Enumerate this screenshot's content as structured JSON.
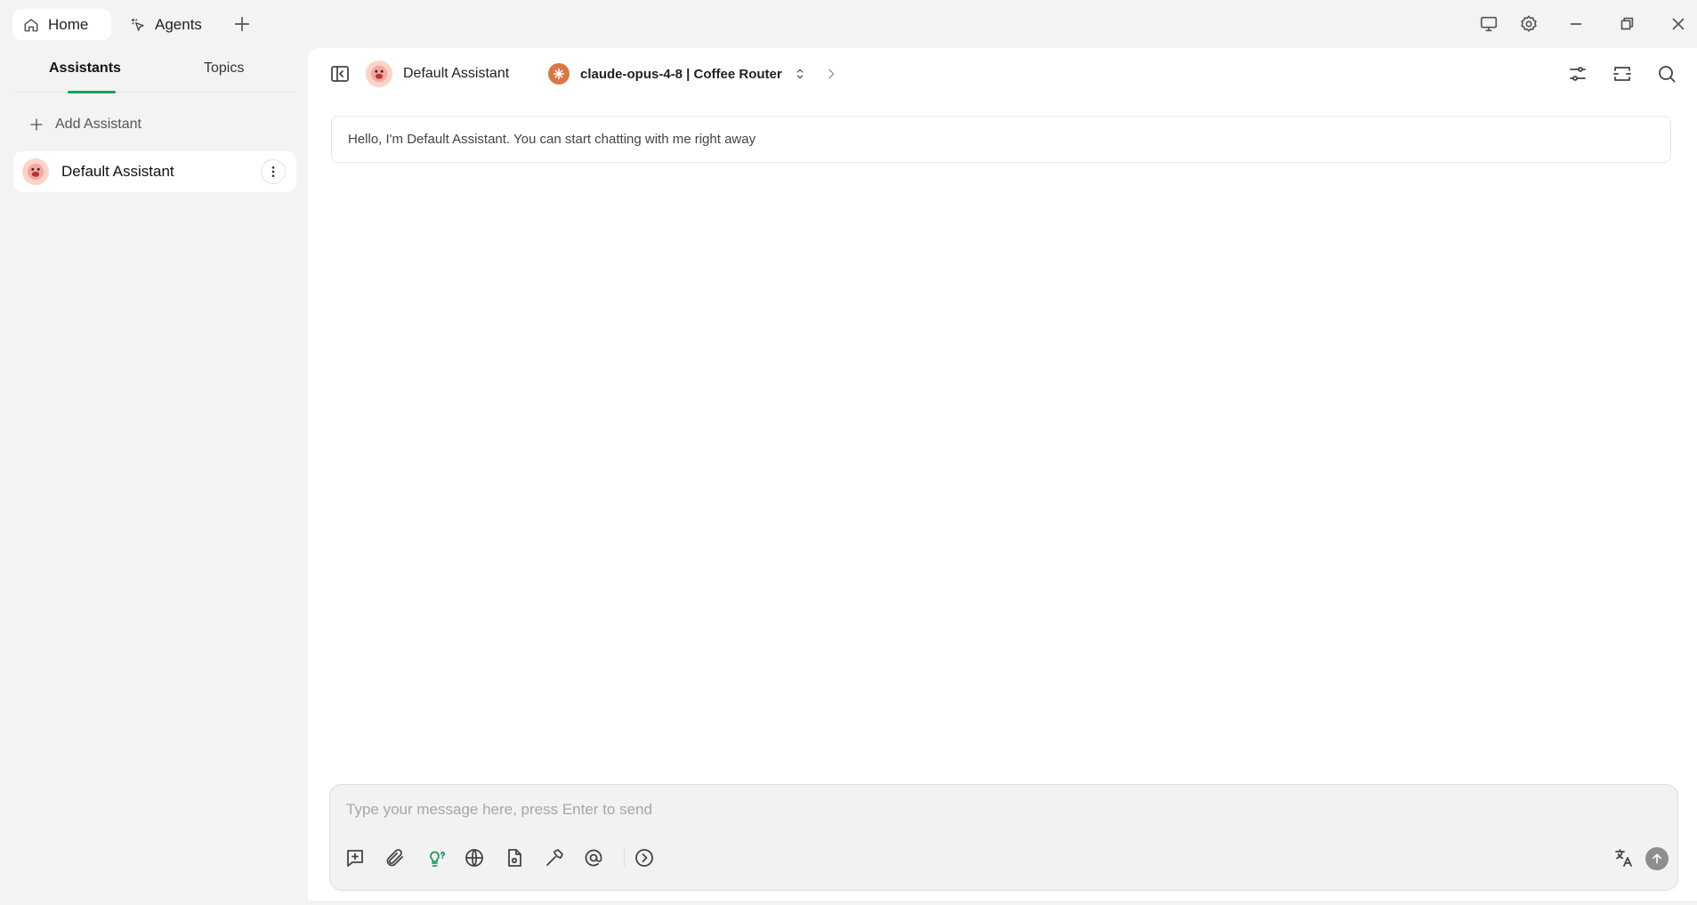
{
  "tabs": [
    {
      "label": "Home",
      "icon": "home-icon",
      "active": true
    },
    {
      "label": "Agents",
      "icon": "sparkle-pointer-icon",
      "active": false
    }
  ],
  "window_controls": [
    "monitor-icon",
    "gear-icon",
    "minimize-icon",
    "restore-icon",
    "close-icon"
  ],
  "sidebar": {
    "tabs": [
      {
        "label": "Assistants",
        "active": true
      },
      {
        "label": "Topics",
        "active": false
      }
    ],
    "add_assistant_label": "Add Assistant",
    "assistants": [
      {
        "name": "Default Assistant",
        "avatar": "emoji-face-avatar"
      }
    ]
  },
  "header": {
    "assistant_name": "Default Assistant",
    "model_label": "claude-opus-4-8 | Coffee Router",
    "right_icons": [
      "settings-sliders-icon",
      "expand-icon",
      "search-icon"
    ]
  },
  "chat": {
    "welcome_message": "Hello, I'm Default Assistant. You can start chatting with me right away"
  },
  "composer": {
    "placeholder": "Type your message here, press Enter to send",
    "value": "",
    "tools": [
      "new-topic-icon",
      "attachment-icon",
      "thinking-bulb-icon",
      "web-search-icon",
      "knowledge-file-icon",
      "mcp-hammer-icon",
      "mention-icon",
      "more-arrow-icon"
    ],
    "right_tools": [
      "translate-icon",
      "send-icon"
    ]
  },
  "colors": {
    "accent": "#18a058",
    "background": "#f3f3f3",
    "panel": "#ffffff",
    "model_logo": "#d97746",
    "avatar_bg": "#fbd4c8"
  }
}
